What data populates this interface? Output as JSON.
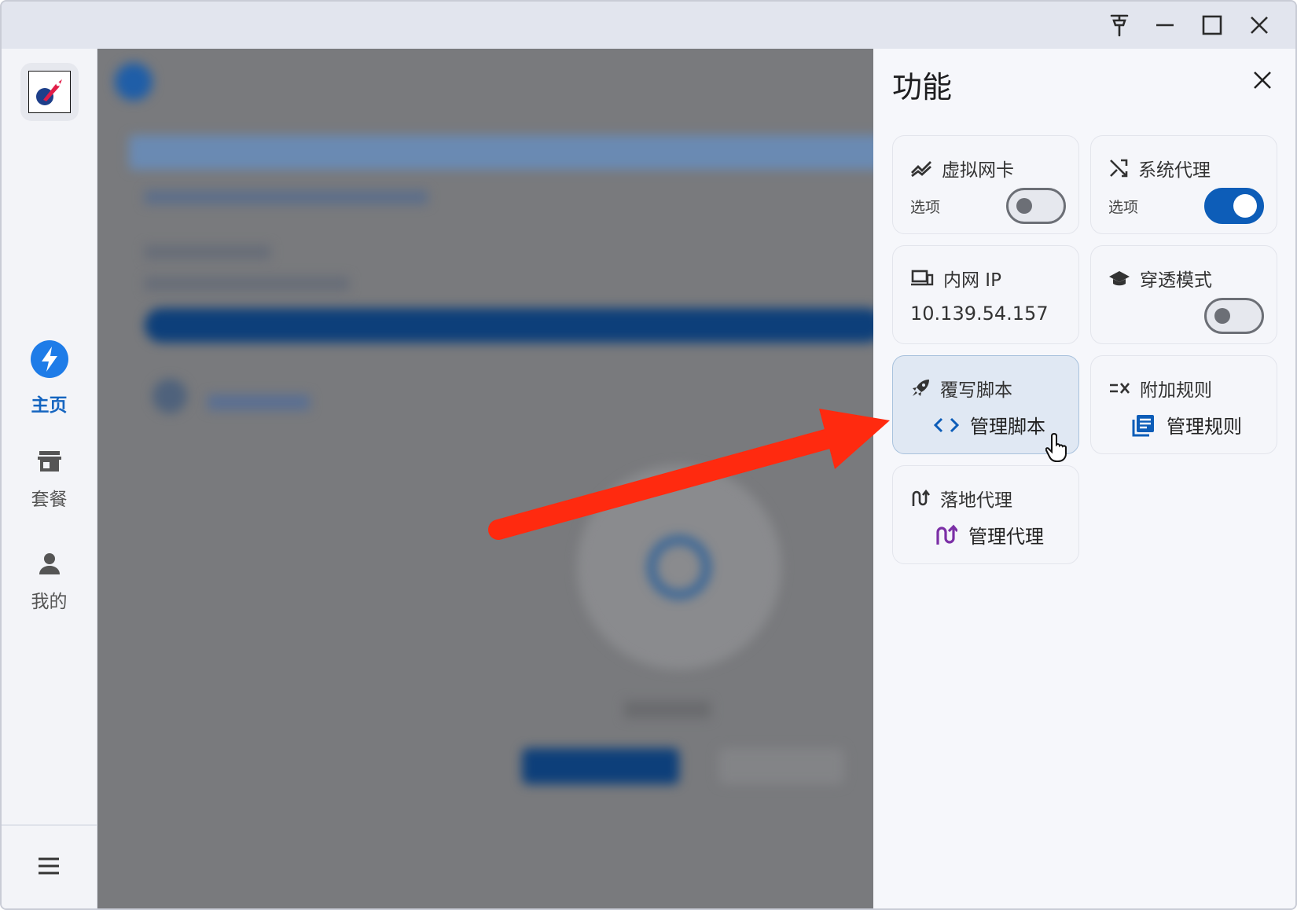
{
  "sidebar": {
    "logo": "rocket-logo-icon",
    "items": [
      {
        "label": "主页",
        "icon": "lightning-icon",
        "active": true
      },
      {
        "label": "套餐",
        "icon": "store-icon",
        "active": false
      },
      {
        "label": "我的",
        "icon": "person-icon",
        "active": false
      }
    ],
    "menu_icon": "hamburger-menu-icon"
  },
  "titlebar": {
    "buttons": [
      "pin-icon",
      "minimize-icon",
      "maximize-icon",
      "close-icon"
    ]
  },
  "drawer": {
    "title": "功能",
    "cards": [
      {
        "key": "tun",
        "title": "虚拟网卡",
        "icon": "network-zigzag-icon",
        "sub": "选项",
        "toggle": false
      },
      {
        "key": "sysproxy",
        "title": "系统代理",
        "icon": "shuffle-icon",
        "sub": "选项",
        "toggle": true
      },
      {
        "key": "lanip",
        "title": "内网 IP",
        "icon": "devices-icon",
        "value": "10.139.54.157"
      },
      {
        "key": "tunnel",
        "title": "穿透模式",
        "icon": "graduation-cap-icon",
        "toggle": false
      },
      {
        "key": "script",
        "title": "覆写脚本",
        "icon": "rocket-icon",
        "action": "管理脚本",
        "action_icon": "code-brackets-icon",
        "selected": true
      },
      {
        "key": "rules",
        "title": "附加规则",
        "icon": "rule-filter-icon",
        "action": "管理规则",
        "action_icon": "document-list-icon"
      },
      {
        "key": "landing",
        "title": "落地代理",
        "icon": "route-icon",
        "action": "管理代理",
        "action_icon": "route-icon"
      }
    ]
  },
  "colors": {
    "accent": "#0d5db8",
    "arrow": "#ff2a0f",
    "selected_card": "#e0e8f3",
    "dim_overlay": "#797a7d",
    "purple_icon": "#7b2fa6"
  }
}
